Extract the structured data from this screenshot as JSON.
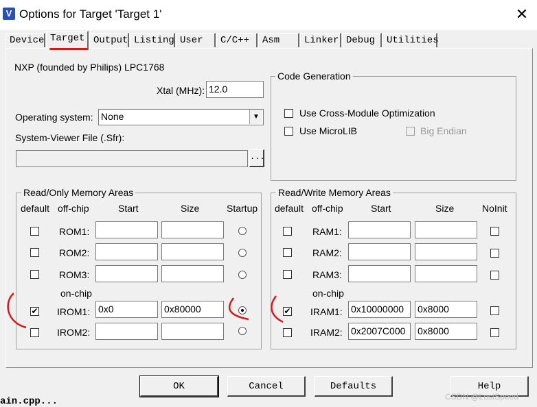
{
  "window": {
    "title": "Options for Target 'Target 1'",
    "close_glyph": "✕"
  },
  "tabs": [
    {
      "label": "Device"
    },
    {
      "label": "Target"
    },
    {
      "label": "Output"
    },
    {
      "label": "Listing"
    },
    {
      "label": "User"
    },
    {
      "label": "C/C++"
    },
    {
      "label": "Asm"
    },
    {
      "label": "Linker"
    },
    {
      "label": "Debug"
    },
    {
      "label": "Utilities"
    }
  ],
  "device_name": "NXP (founded by Philips) LPC1768",
  "xtal": {
    "label": "Xtal (MHz):",
    "value": "12.0"
  },
  "os": {
    "label": "Operating system:",
    "value": "None"
  },
  "sfr": {
    "label": "System-Viewer File (.Sfr):",
    "value": "",
    "browse": "..."
  },
  "code_gen": {
    "title": "Code Generation",
    "cross_module": {
      "label": "Use Cross-Module Optimization",
      "checked": false
    },
    "microlib": {
      "label": "Use MicroLIB",
      "checked": false
    },
    "big_endian": {
      "label": "Big Endian",
      "checked": false,
      "disabled": true
    }
  },
  "ro_mem": {
    "title": "Read/Only Memory Areas",
    "headers": {
      "default": "default",
      "offchip": "off-chip",
      "start": "Start",
      "size": "Size",
      "last": "Startup"
    },
    "onchip_label": "on-chip",
    "rows": [
      {
        "name": "ROM1:",
        "start": "",
        "size": "",
        "default": false,
        "startup": false
      },
      {
        "name": "ROM2:",
        "start": "",
        "size": "",
        "default": false,
        "startup": false
      },
      {
        "name": "ROM3:",
        "start": "",
        "size": "",
        "default": false,
        "startup": false
      },
      {
        "name": "IROM1:",
        "start": "0x0",
        "size": "0x80000",
        "default": true,
        "startup": true
      },
      {
        "name": "IROM2:",
        "start": "",
        "size": "",
        "default": false,
        "startup": false
      }
    ]
  },
  "rw_mem": {
    "title": "Read/Write Memory Areas",
    "headers": {
      "default": "default",
      "offchip": "off-chip",
      "start": "Start",
      "size": "Size",
      "last": "NoInit"
    },
    "onchip_label": "on-chip",
    "rows": [
      {
        "name": "RAM1:",
        "start": "",
        "size": "",
        "default": false,
        "noinit": false
      },
      {
        "name": "RAM2:",
        "start": "",
        "size": "",
        "default": false,
        "noinit": false
      },
      {
        "name": "RAM3:",
        "start": "",
        "size": "",
        "default": false,
        "noinit": false
      },
      {
        "name": "IRAM1:",
        "start": "0x10000000",
        "size": "0x8000",
        "default": true,
        "noinit": false
      },
      {
        "name": "IRAM2:",
        "start": "0x2007C000",
        "size": "0x8000",
        "default": false,
        "noinit": false
      }
    ]
  },
  "buttons": {
    "ok": "OK",
    "cancel": "Cancel",
    "defaults": "Defaults",
    "help": "Help"
  },
  "bg_text": "ain.cpp...",
  "watermark": "CSDN @LostSpeed",
  "colors": {
    "annotation_red": "#d41a1a",
    "app_icon_blue": "#2b4fb8"
  }
}
